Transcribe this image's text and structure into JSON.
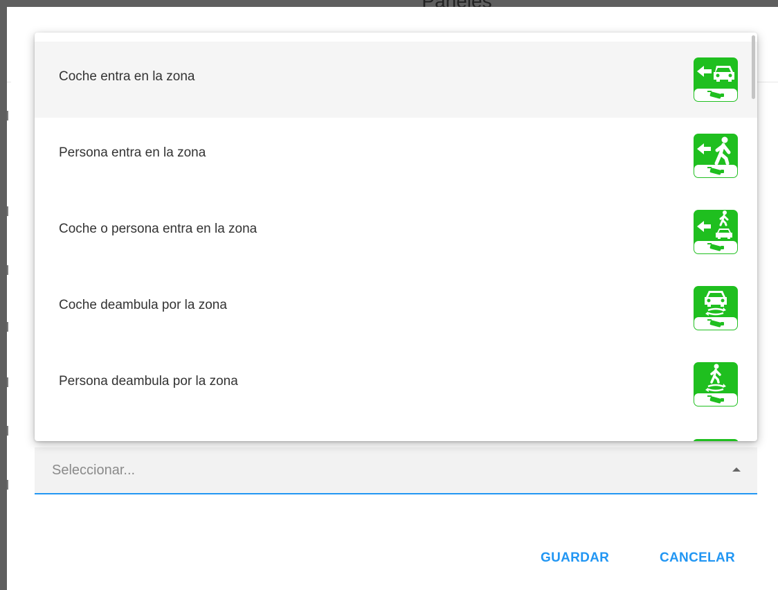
{
  "dialog": {
    "backdrop_title": "Paneles"
  },
  "dropdown": {
    "options": [
      {
        "label": "Coche entra en la zona",
        "icon": "car-enters-zone-icon"
      },
      {
        "label": "Persona entra en la zona",
        "icon": "person-enters-zone-icon"
      },
      {
        "label": "Coche o persona entra en la zona",
        "icon": "car-or-person-enters-zone-icon"
      },
      {
        "label": "Coche deambula por la zona",
        "icon": "car-loiters-zone-icon"
      },
      {
        "label": "Persona deambula por la zona",
        "icon": "person-loiters-zone-icon"
      }
    ]
  },
  "select": {
    "placeholder": "Seleccionar..."
  },
  "actions": {
    "save_label": "GUARDAR",
    "cancel_label": "CANCELAR"
  },
  "colors": {
    "accent": "#2196f3",
    "icon_green": "#1fbf1f"
  }
}
